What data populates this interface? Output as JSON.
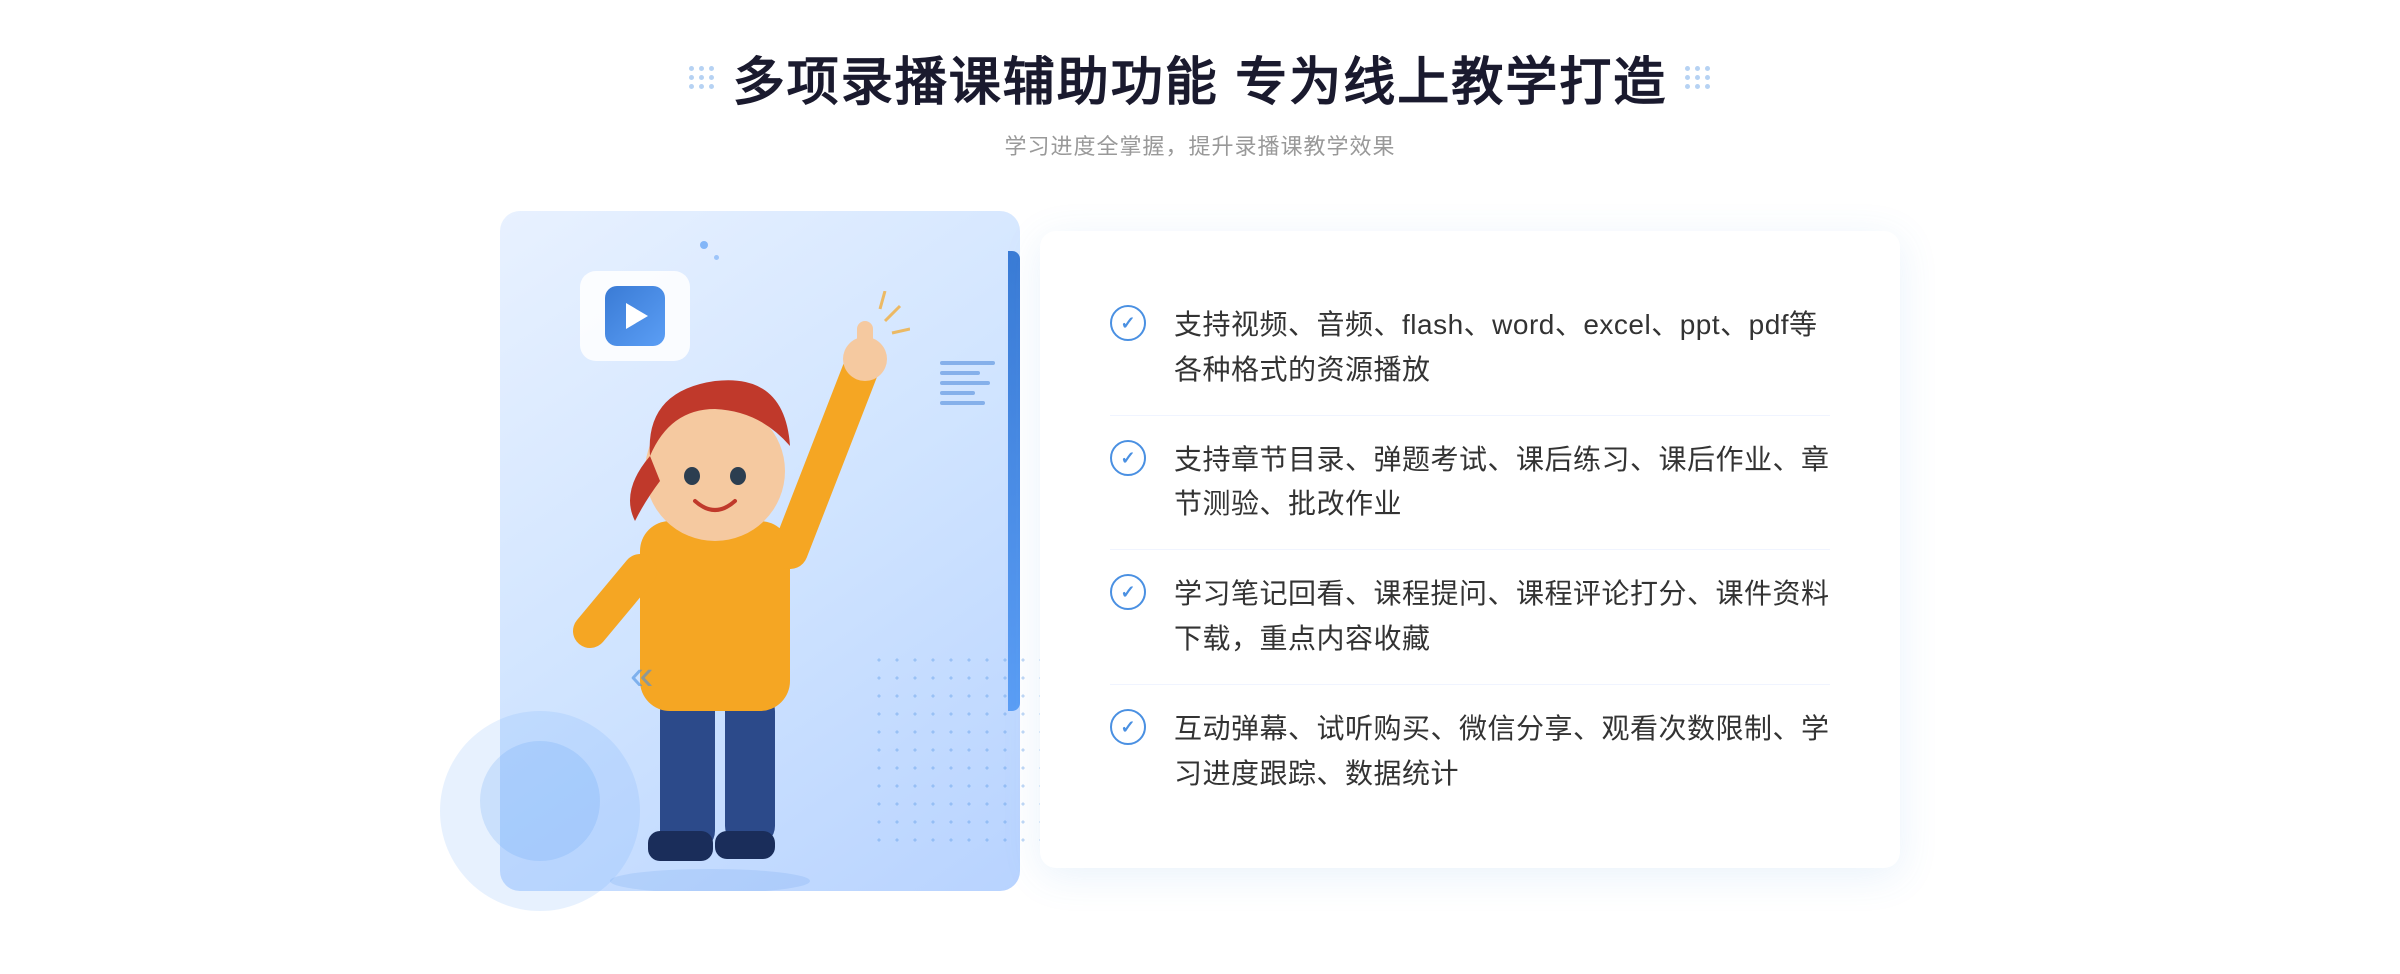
{
  "header": {
    "title": "多项录播课辅助功能 专为线上教学打造",
    "subtitle": "学习进度全掌握，提升录播课教学效果"
  },
  "features": [
    {
      "id": 1,
      "text": "支持视频、音频、flash、word、excel、ppt、pdf等各种格式的资源播放"
    },
    {
      "id": 2,
      "text": "支持章节目录、弹题考试、课后练习、课后作业、章节测验、批改作业"
    },
    {
      "id": 3,
      "text": "学习笔记回看、课程提问、课程评论打分、课件资料下载，重点内容收藏"
    },
    {
      "id": 4,
      "text": "互动弹幕、试听购买、微信分享、观看次数限制、学习进度跟踪、数据统计"
    }
  ],
  "decorations": {
    "chevron": "»",
    "left_chevron": "«",
    "check_mark": "✓"
  }
}
